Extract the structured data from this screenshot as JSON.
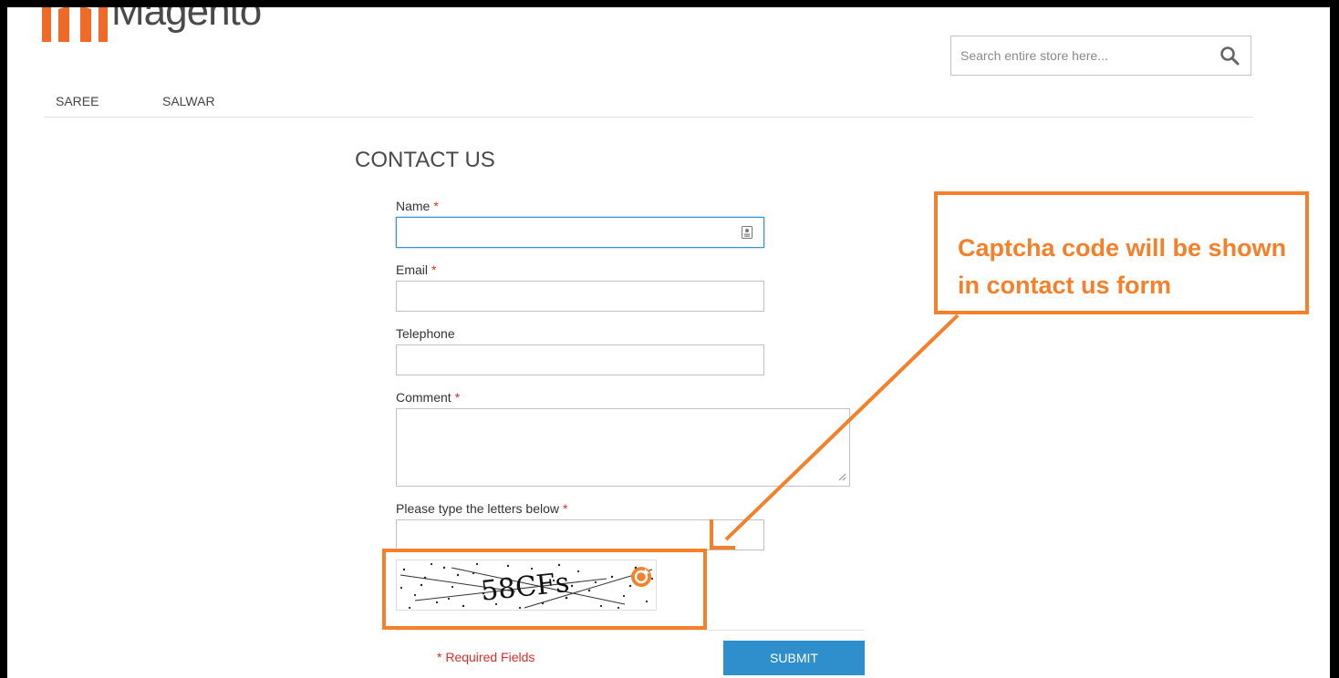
{
  "header": {
    "logo_text": "Magento",
    "search_placeholder": "Search entire store here..."
  },
  "nav": {
    "items": [
      {
        "label": "SAREE"
      },
      {
        "label": "SALWAR"
      }
    ]
  },
  "page": {
    "title": "CONTACT US"
  },
  "form": {
    "name_label": "Name",
    "email_label": "Email",
    "telephone_label": "Telephone",
    "comment_label": "Comment",
    "captcha_label": "Please type the letters below",
    "required_mark": "*",
    "required_note": "* Required Fields",
    "submit_label": "SUBMIT",
    "captcha_code": "58CFs"
  },
  "annotation": {
    "callout": "Captcha code will be shown in contact us form"
  },
  "colors": {
    "accent": "#f4802a",
    "brand": "#ef6a26",
    "button": "#2f8fcd",
    "required": "#e02b27"
  }
}
